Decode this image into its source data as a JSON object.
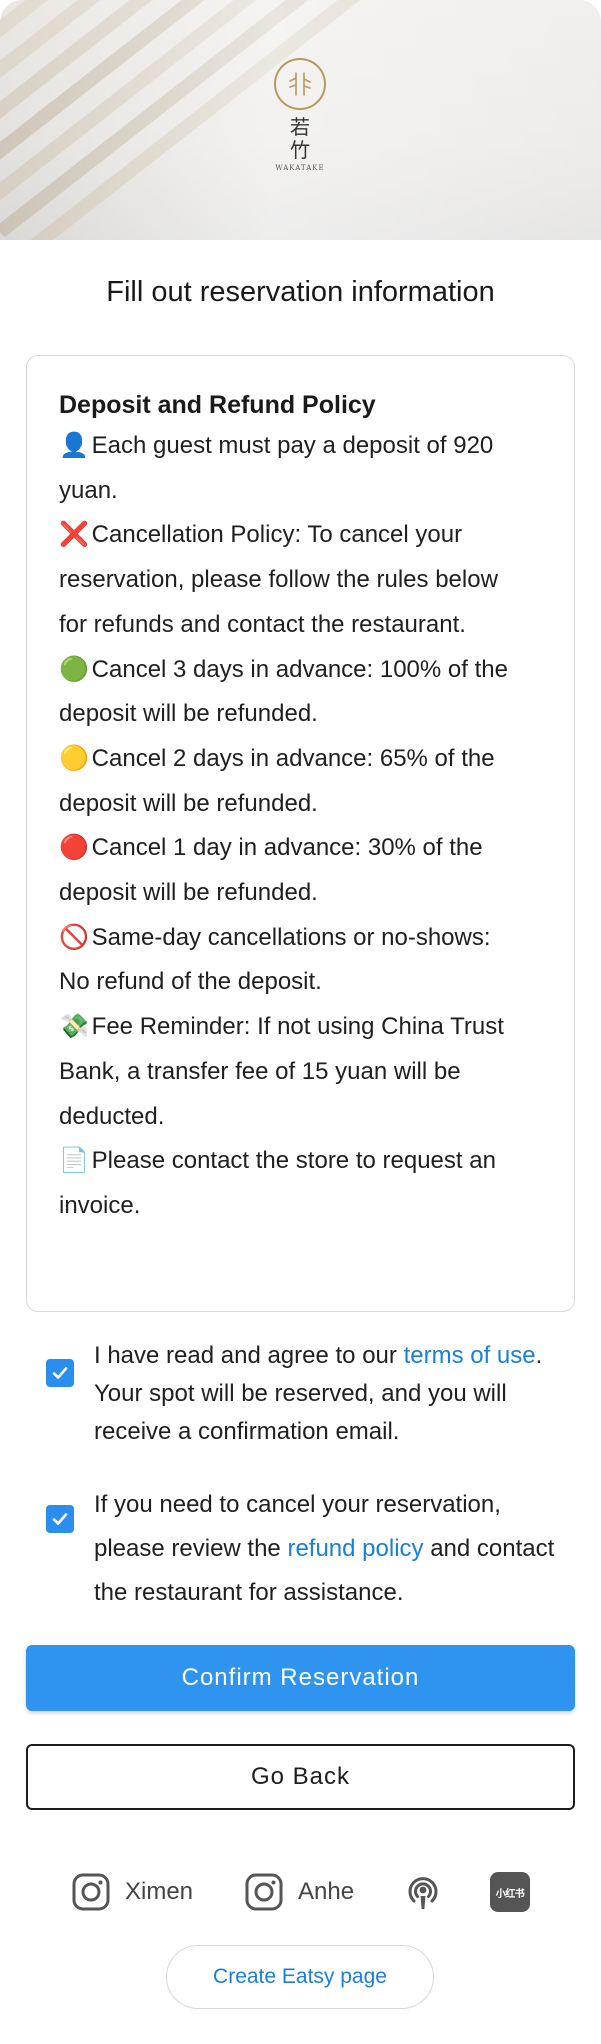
{
  "brand": {
    "kanji_line1": "若",
    "kanji_line2": "竹",
    "roman": "WAKATAKE"
  },
  "page_title": "Fill out reservation information",
  "policy": {
    "heading": "Deposit and Refund Policy",
    "lines": [
      {
        "icon": "👤",
        "icon_name": "person-icon",
        "text": "Each guest must pay a deposit of 920\nyuan."
      },
      {
        "icon": "❌",
        "icon_name": "cross-icon",
        "text": "Cancellation Policy: To cancel your\nreservation, please follow the rules below\nfor refunds and contact the restaurant.\n"
      },
      {
        "icon": "🟢",
        "icon_name": "green-circle-icon",
        "text": "Cancel 3 days in advance: 100% of the\ndeposit will be refunded."
      },
      {
        "icon": "🟡",
        "icon_name": "yellow-circle-icon",
        "text": "Cancel 2 days in advance: 65% of the\ndeposit will be refunded."
      },
      {
        "icon": "🔴",
        "icon_name": "red-circle-icon",
        "text": "Cancel 1 day in advance: 30% of the\ndeposit will be refunded."
      },
      {
        "icon": "🚫",
        "icon_name": "prohibited-icon",
        "text": "Same-day cancellations or no-shows:\nNo refund of the deposit."
      },
      {
        "icon": "💸",
        "icon_name": "money-wings-icon",
        "text": "Fee Reminder: If not using China Trust\nBank, a transfer fee of 15 yuan will be\ndeducted."
      },
      {
        "icon": "📄",
        "icon_name": "document-icon",
        "text": "Please contact the store to request an\ninvoice."
      }
    ]
  },
  "agreements": [
    {
      "checked": true,
      "before": "I have read and agree to our ",
      "link": "terms of use",
      "after": ". Your spot will be reserved, and you will receive a confirmation email."
    },
    {
      "checked": true,
      "before": "If you need to cancel your reservation, please review the ",
      "link": "refund policy",
      "after": " and contact the restaurant for assistance."
    }
  ],
  "buttons": {
    "confirm": "Confirm Reservation",
    "back": "Go Back",
    "eatsy": "Create Eatsy page"
  },
  "socials": [
    {
      "icon_name": "instagram-icon",
      "label": "Ximen"
    },
    {
      "icon_name": "instagram-icon",
      "label": "Anhe"
    },
    {
      "icon_name": "podcast-icon",
      "label": ""
    },
    {
      "icon_name": "xiaohongshu-icon",
      "label": "小红书"
    }
  ],
  "colors": {
    "accent": "#2f93f0",
    "link": "#1a7fd9",
    "logo_gold": "#b79a5c"
  }
}
